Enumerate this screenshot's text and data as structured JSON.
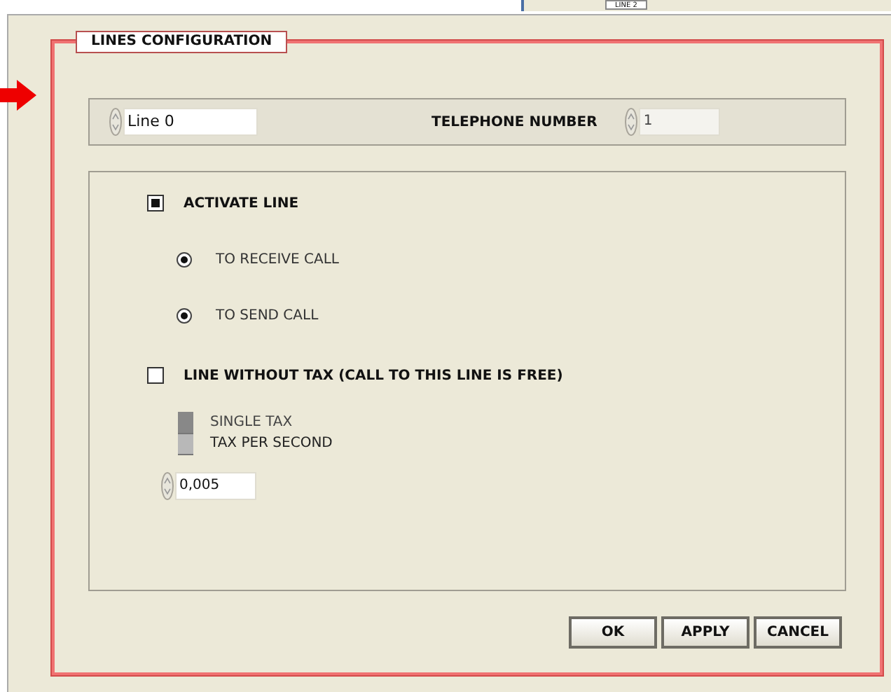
{
  "background_tab": {
    "label": "LINE 2"
  },
  "panel": {
    "title": "LINES CONFIGURATION"
  },
  "line_selector": {
    "value": "Line 0"
  },
  "telephone_number": {
    "label": "TELEPHONE NUMBER",
    "value": "1"
  },
  "activate_line": {
    "label": "ACTIVATE LINE",
    "checked": true
  },
  "call_modes": [
    {
      "label": "TO RECEIVE CALL",
      "checked": true
    },
    {
      "label": "TO SEND CALL",
      "checked": true
    }
  ],
  "line_without_tax": {
    "label": "LINE WITHOUT TAX  (CALL TO THIS LINE IS FREE)",
    "checked": false
  },
  "tax_modes": [
    {
      "label": "SINGLE TAX",
      "selected": false
    },
    {
      "label": "TAX PER SECOND",
      "selected": true
    }
  ],
  "tax_value": {
    "value": "0,005"
  },
  "buttons": [
    "OK",
    "APPLY",
    "CANCEL"
  ]
}
